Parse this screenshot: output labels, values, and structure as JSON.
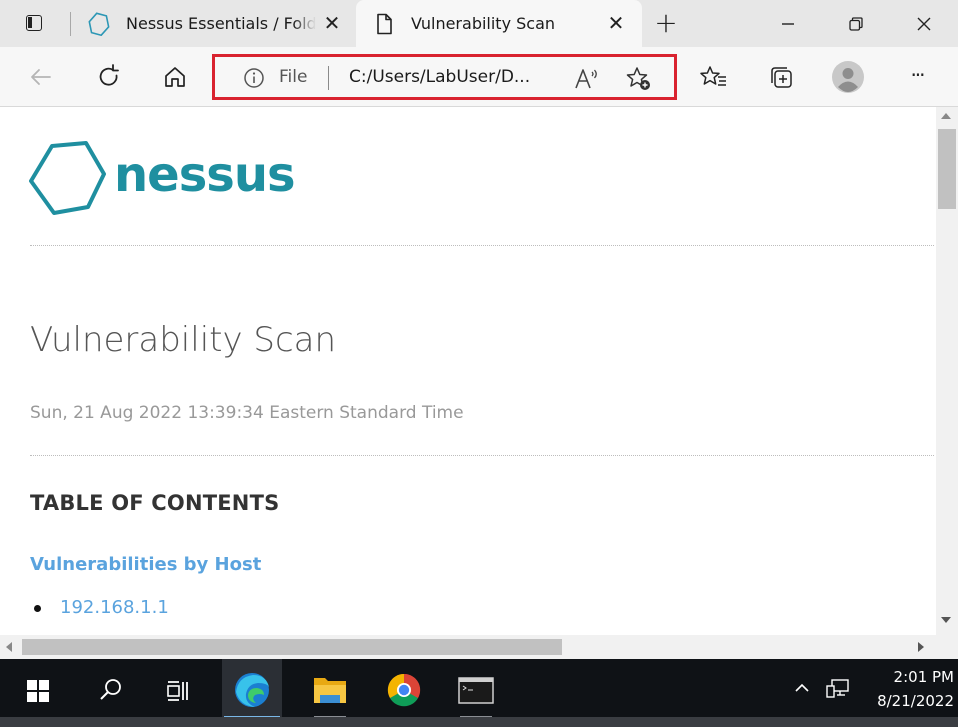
{
  "browser": {
    "tabs": [
      {
        "title": "Nessus Essentials / Folders / View Scan",
        "icon": "nessus-hexagon-icon",
        "active": false
      },
      {
        "title": "Vulnerability Scan",
        "icon": "document-icon",
        "active": true
      }
    ],
    "address": {
      "scheme_label": "File",
      "url_display": "C:/Users/LabUser/D..."
    },
    "window_controls": {
      "minimize_glyph": "—",
      "maximize_glyph": "❐",
      "close_glyph": "✕"
    },
    "tab_close_glyph": "✕",
    "new_tab_glyph": "+",
    "more_glyph": "···"
  },
  "page": {
    "logo_text": "nessus",
    "report_title": "Vulnerability Scan",
    "report_date": "Sun, 21 Aug 2022 13:39:34 Eastern Standard Time",
    "toc_heading": "TABLE OF CONTENTS",
    "toc_section": "Vulnerabilities by Host",
    "toc_items": [
      "192.168.1.1"
    ]
  },
  "taskbar": {
    "items": [
      "start-icon",
      "search-icon",
      "task-view-icon",
      "edge-icon",
      "file-explorer-icon",
      "chrome-icon",
      "terminal-icon"
    ],
    "clock_time": "2:01 PM",
    "clock_date": "8/21/2022"
  },
  "colors": {
    "accent_teal": "#1f8fa0",
    "link_blue": "#5aa3de",
    "highlight_red": "#d9232f"
  }
}
